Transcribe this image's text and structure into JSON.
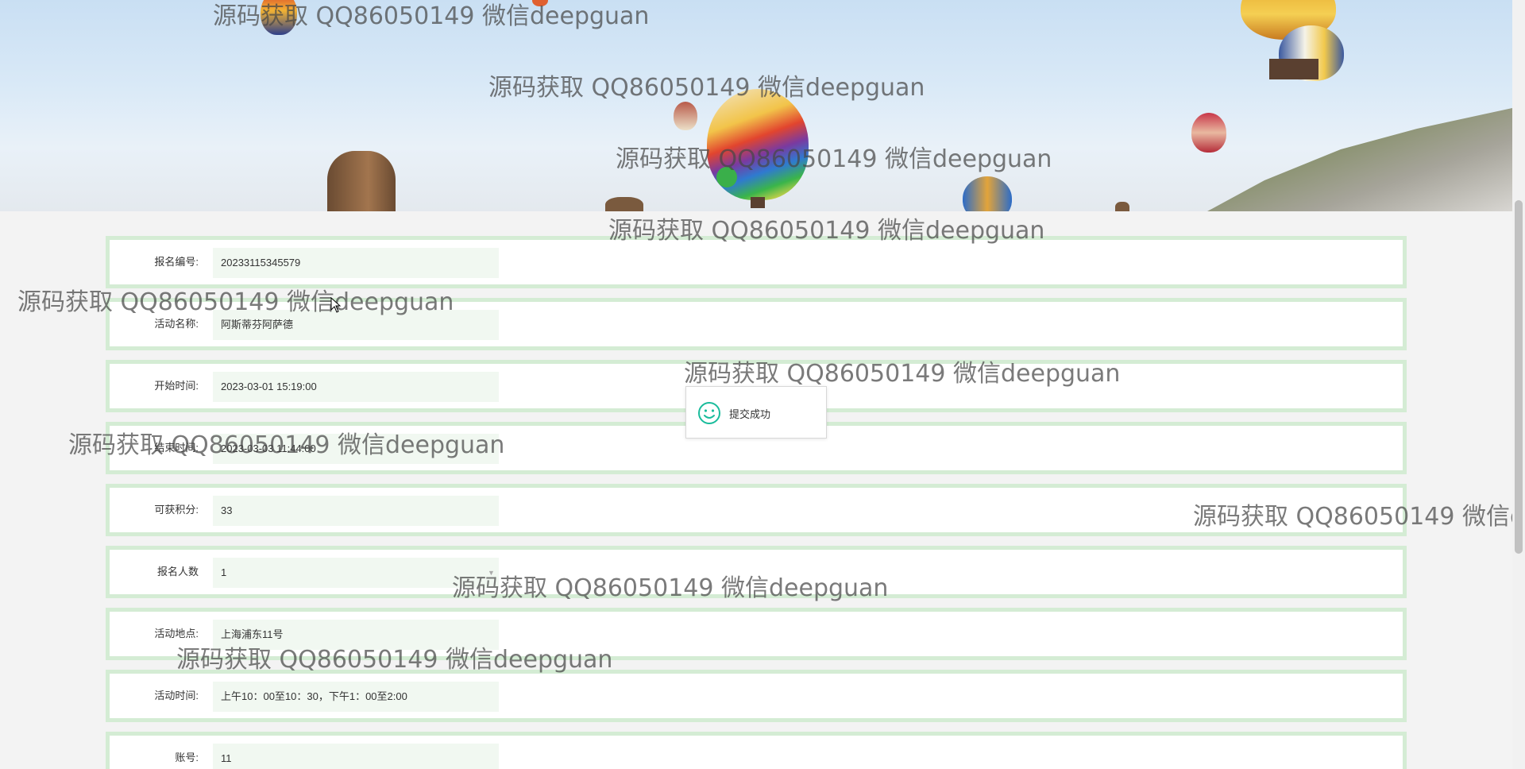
{
  "form": {
    "rows": [
      {
        "label": "报名编号:",
        "value": "20233115345579"
      },
      {
        "label": "活动名称:",
        "value": "阿斯蒂芬阿萨德"
      },
      {
        "label": "开始时间:",
        "value": "2023-03-01 15:19:00"
      },
      {
        "label": "结束时间:",
        "value": "2023-03-03 11:44:00"
      },
      {
        "label": "可获积分:",
        "value": "33"
      },
      {
        "label": "报名人数",
        "value": "1"
      },
      {
        "label": "活动地点:",
        "value": "上海浦东11号"
      },
      {
        "label": "活动时间:",
        "value": "上午10：00至10：30，下午1：00至2:00"
      },
      {
        "label": "账号:",
        "value": "11"
      }
    ]
  },
  "toast": {
    "message": "提交成功",
    "icon": "smile-icon",
    "color": "#1abc9c"
  },
  "watermark_text": "源码获取 QQ86050149 微信deepguan",
  "colors": {
    "row_border": "#d4ecd4",
    "input_bg": "#f1f8f1",
    "page_bg": "#f3f3f3"
  }
}
